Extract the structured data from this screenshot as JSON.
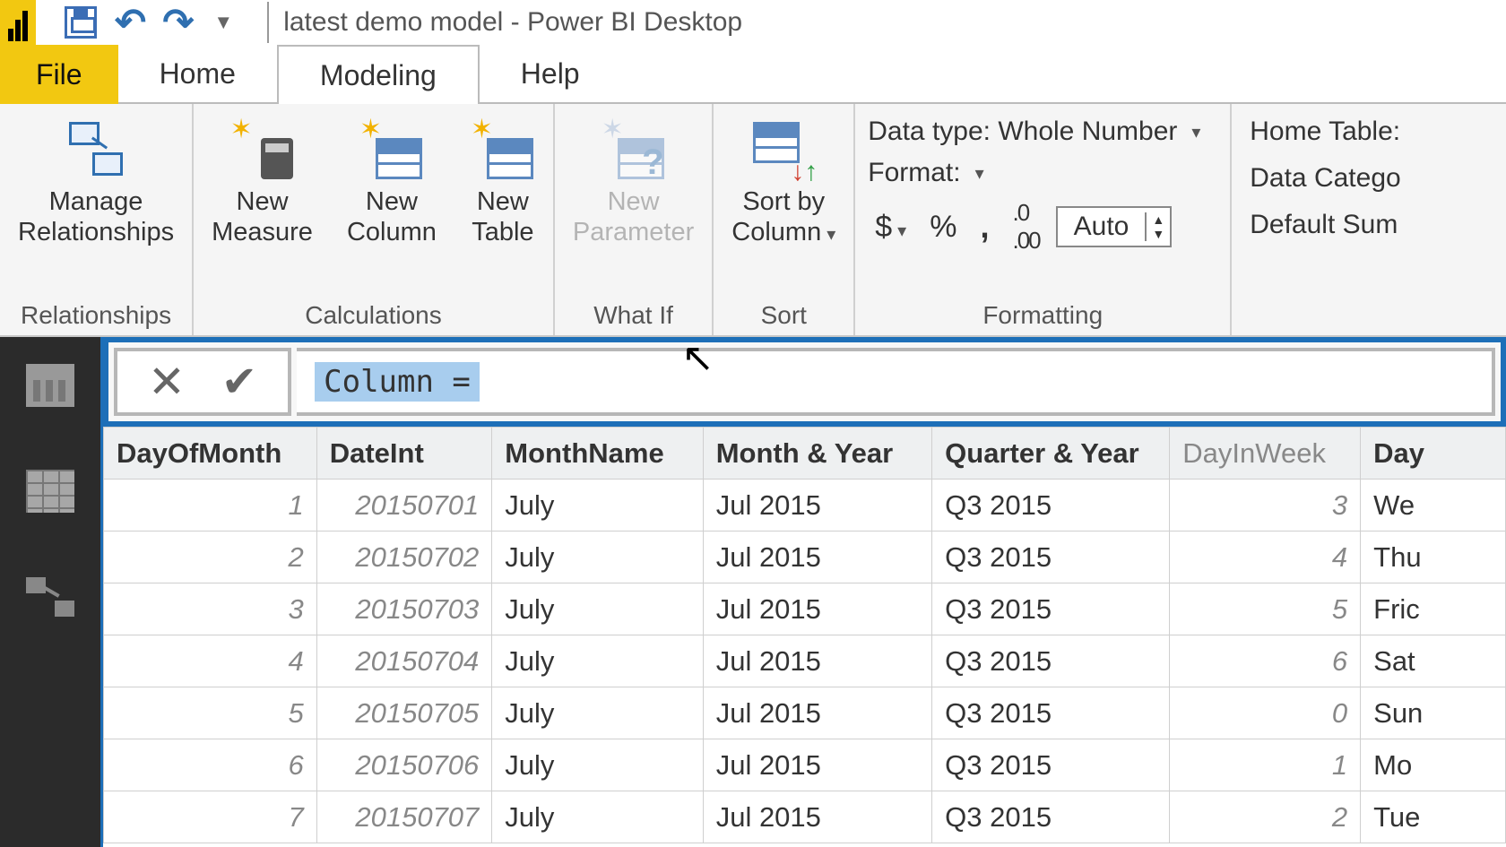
{
  "title": "latest demo model - Power BI Desktop",
  "tabs": {
    "file": "File",
    "home": "Home",
    "modeling": "Modeling",
    "help": "Help"
  },
  "ribbon": {
    "relationships": {
      "manage": "Manage\nRelationships",
      "group": "Relationships"
    },
    "calc": {
      "measure": "New\nMeasure",
      "column": "New\nColumn",
      "table": "New\nTable",
      "group": "Calculations"
    },
    "whatif": {
      "param": "New\nParameter",
      "group": "What If"
    },
    "sort": {
      "sortby": "Sort by\nColumn",
      "group": "Sort"
    },
    "format": {
      "datatype": "Data type: Whole Number",
      "format": "Format:",
      "auto": "Auto",
      "group": "Formatting"
    },
    "props": {
      "home": "Home Table:",
      "cat": "Data Catego",
      "sum": "Default Sum"
    }
  },
  "formula": "Column =",
  "columns": [
    "DayOfMonth",
    "DateInt",
    "MonthName",
    "Month & Year",
    "Quarter & Year",
    "DayInWeek",
    "Day"
  ],
  "rows": [
    {
      "dom": "1",
      "di": "20150701",
      "mn": "July",
      "my": "Jul 2015",
      "qy": "Q3 2015",
      "dw": "3",
      "dy": "We"
    },
    {
      "dom": "2",
      "di": "20150702",
      "mn": "July",
      "my": "Jul 2015",
      "qy": "Q3 2015",
      "dw": "4",
      "dy": "Thu"
    },
    {
      "dom": "3",
      "di": "20150703",
      "mn": "July",
      "my": "Jul 2015",
      "qy": "Q3 2015",
      "dw": "5",
      "dy": "Fric"
    },
    {
      "dom": "4",
      "di": "20150704",
      "mn": "July",
      "my": "Jul 2015",
      "qy": "Q3 2015",
      "dw": "6",
      "dy": "Sat"
    },
    {
      "dom": "5",
      "di": "20150705",
      "mn": "July",
      "my": "Jul 2015",
      "qy": "Q3 2015",
      "dw": "0",
      "dy": "Sun"
    },
    {
      "dom": "6",
      "di": "20150706",
      "mn": "July",
      "my": "Jul 2015",
      "qy": "Q3 2015",
      "dw": "1",
      "dy": "Mo"
    },
    {
      "dom": "7",
      "di": "20150707",
      "mn": "July",
      "my": "Jul 2015",
      "qy": "Q3 2015",
      "dw": "2",
      "dy": "Tue"
    }
  ]
}
